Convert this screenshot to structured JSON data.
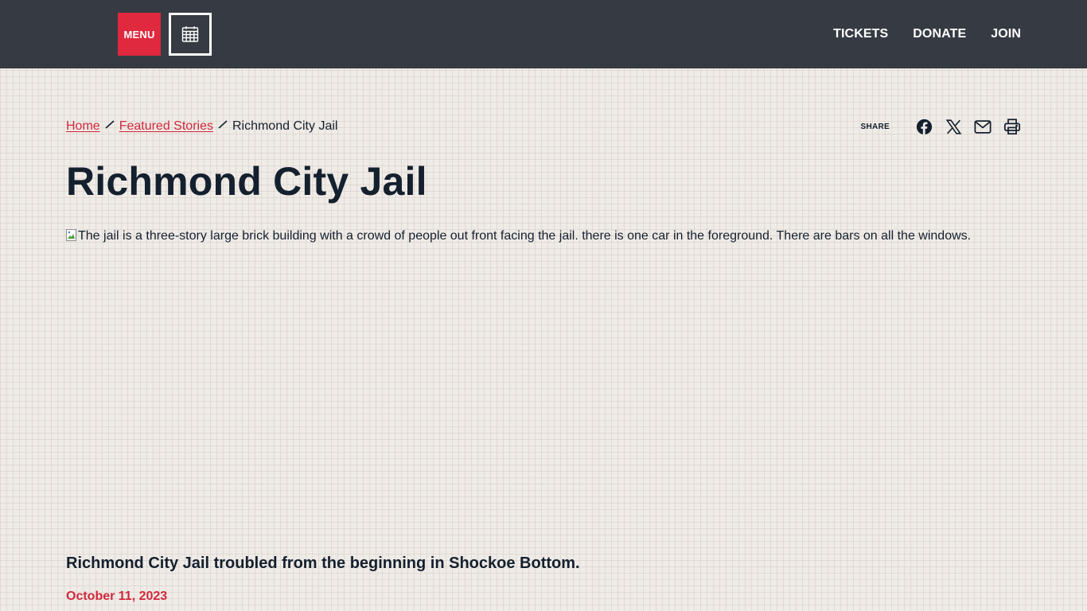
{
  "header": {
    "menu_label": "MENU",
    "calendar_icon": "calendar-icon",
    "nav": [
      {
        "label": "TICKETS"
      },
      {
        "label": "DONATE"
      },
      {
        "label": "JOIN"
      }
    ]
  },
  "breadcrumb": {
    "items": [
      {
        "label": "Home"
      },
      {
        "label": "Featured Stories"
      }
    ],
    "current": "Richmond City Jail",
    "separator": "/"
  },
  "share": {
    "label": "SHARE",
    "icons": [
      "facebook-icon",
      "x-icon",
      "email-icon",
      "print-icon"
    ]
  },
  "article": {
    "title": "Richmond City Jail",
    "image_alt": "The jail is a three-story large brick building with a crowd of people out front facing the jail. there is one car in the foreground. There are bars on all the windows.",
    "subtitle": "Richmond City Jail troubled from the beginning in Shockoe Bottom.",
    "date": "October 11, 2023"
  },
  "colors": {
    "header_bg": "#363b43",
    "accent_red": "#e0283e",
    "link_red": "#d2283c",
    "text_dark": "#14202e",
    "page_bg": "#efebe7"
  }
}
